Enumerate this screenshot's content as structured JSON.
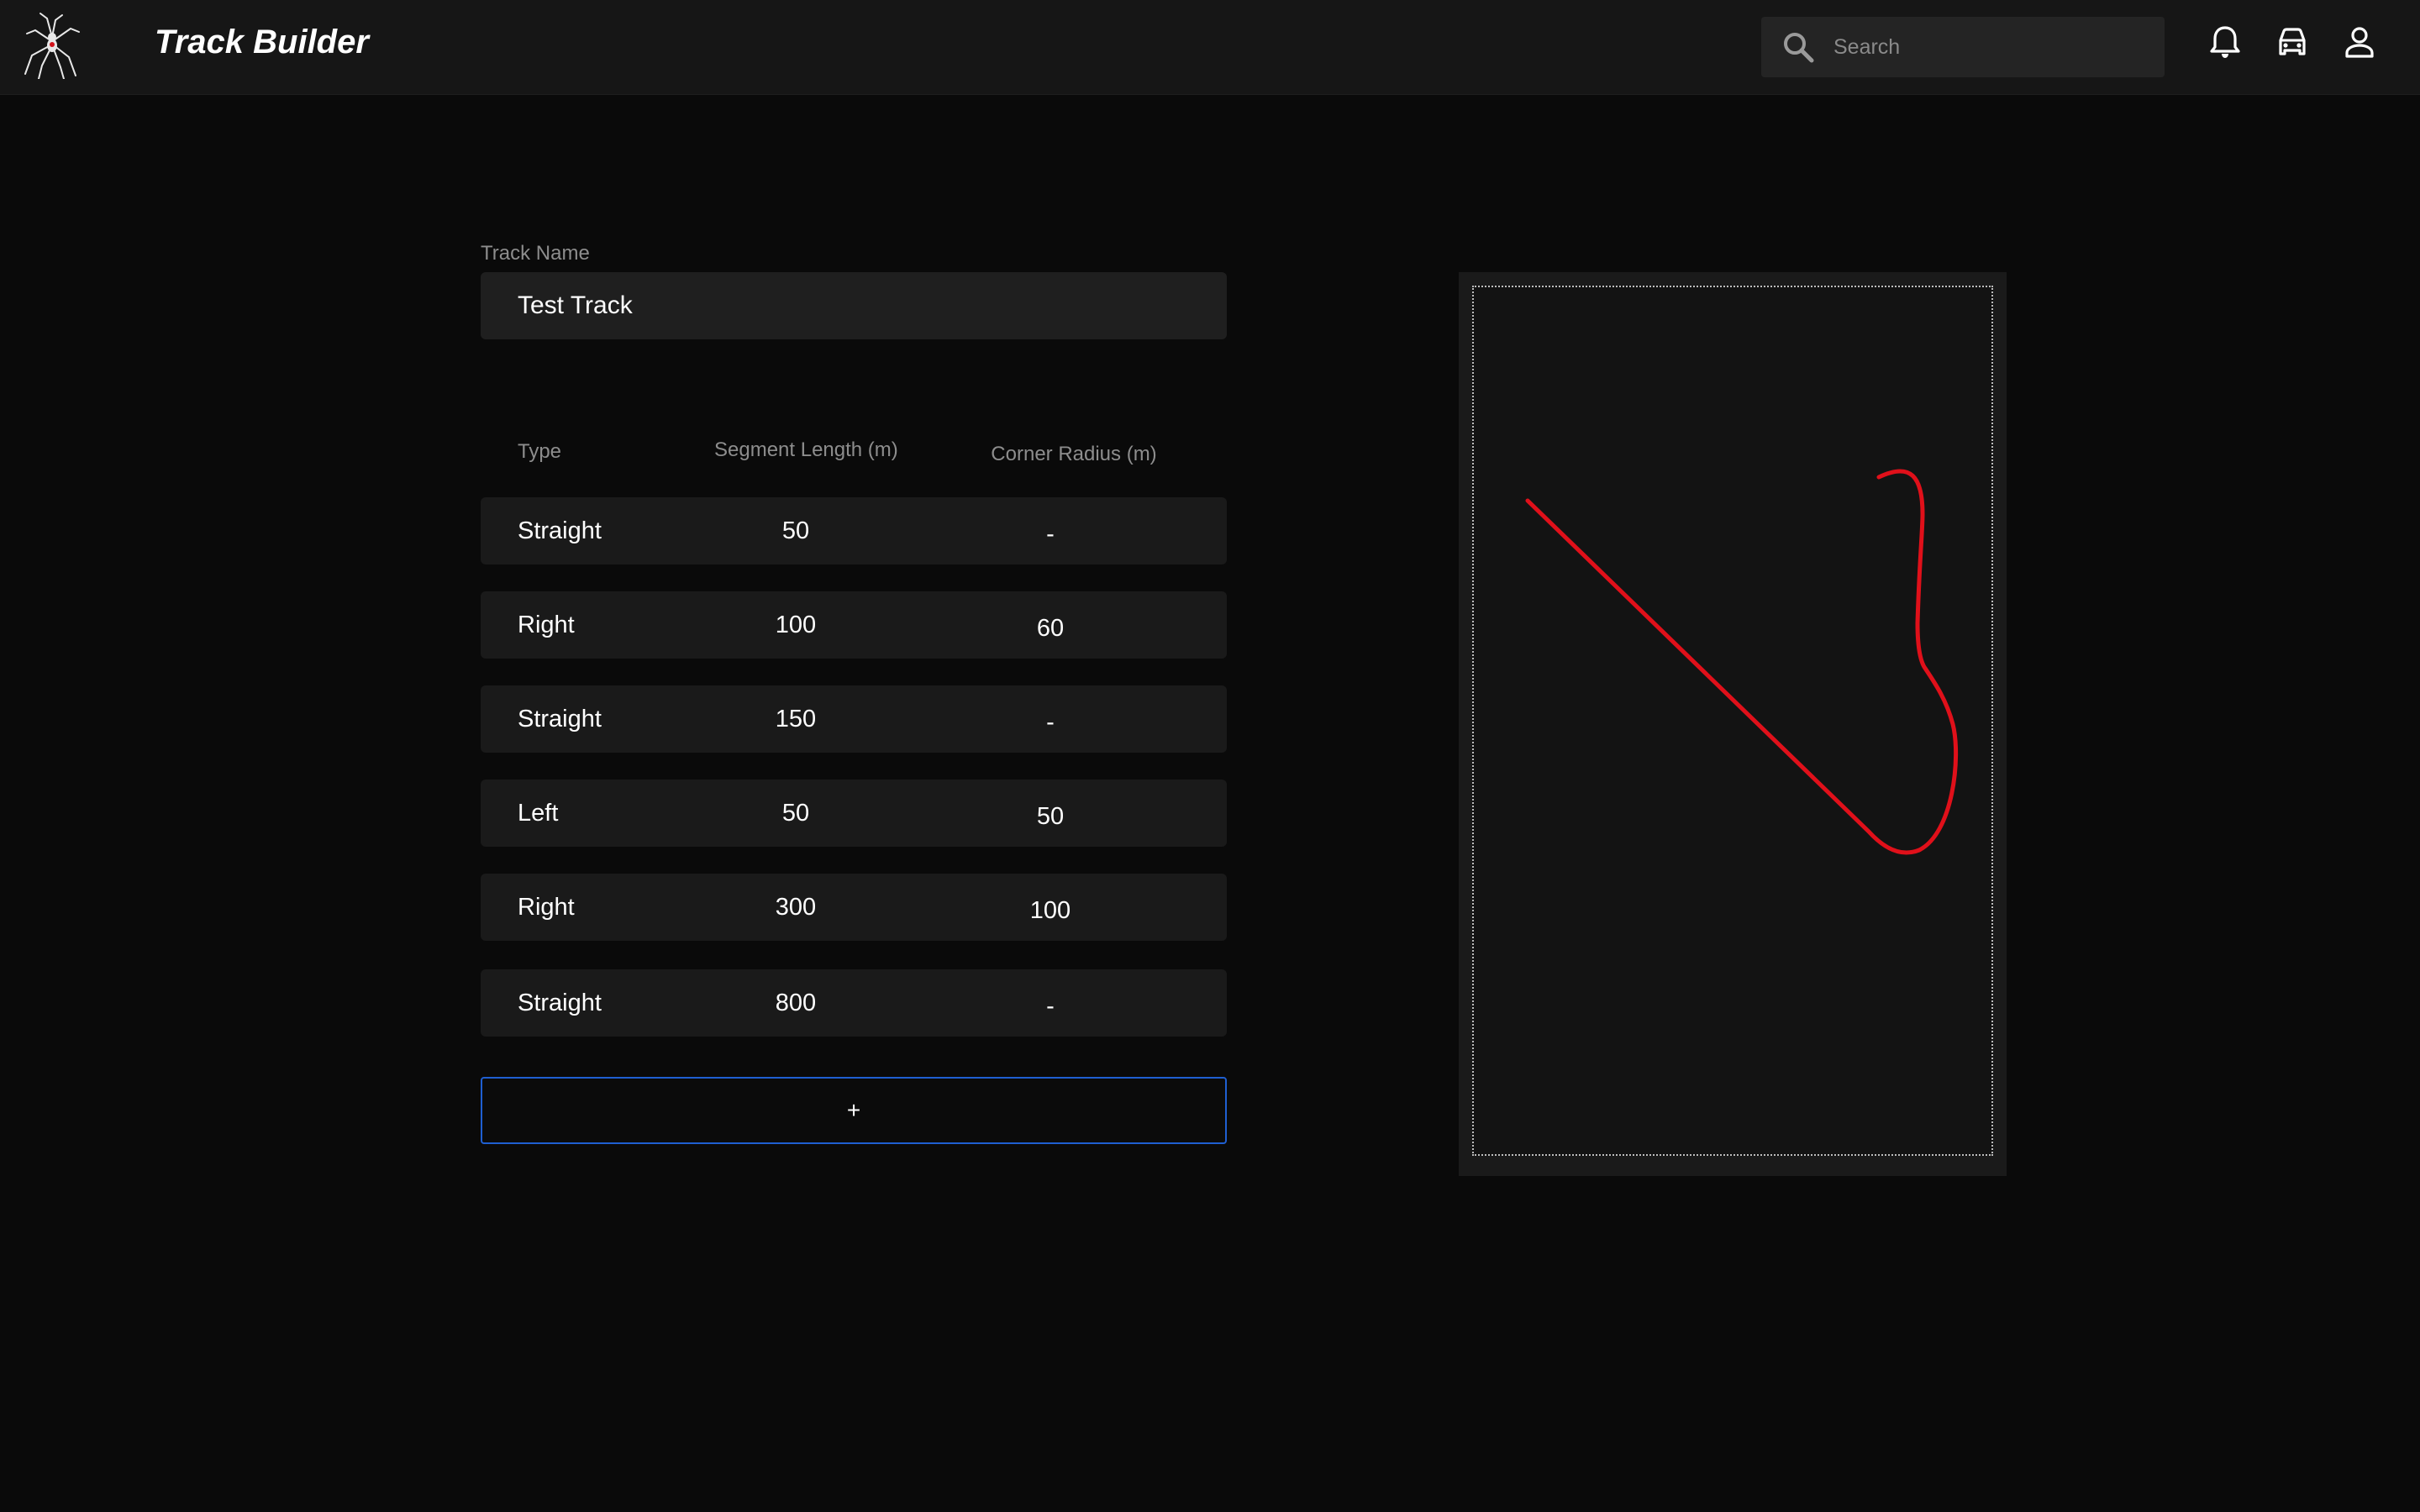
{
  "header": {
    "title": "Track Builder",
    "logo_icon": "spider-logo-icon",
    "search": {
      "placeholder": "Search",
      "value": ""
    },
    "icons": [
      "bell-icon",
      "car-icon",
      "user-icon"
    ]
  },
  "form": {
    "track_name_label": "Track Name",
    "track_name_value": "Test Track"
  },
  "table": {
    "headers": {
      "type": "Type",
      "length": "Segment Length (m)",
      "radius": "Corner Radius (m)"
    },
    "rows": [
      {
        "type": "Straight",
        "length": "50",
        "radius": "-"
      },
      {
        "type": "Right",
        "length": "100",
        "radius": "60"
      },
      {
        "type": "Straight",
        "length": "150",
        "radius": "-"
      },
      {
        "type": "Left",
        "length": "50",
        "radius": "50"
      },
      {
        "type": "Right",
        "length": "300",
        "radius": "100"
      },
      {
        "type": "Straight",
        "length": "800",
        "radius": "-"
      }
    ]
  },
  "add_button_label": "+",
  "colors": {
    "accent": "#1f5fd1",
    "track_line": "#e0101a",
    "background": "#0a0a0a",
    "topbar": "#161616"
  }
}
